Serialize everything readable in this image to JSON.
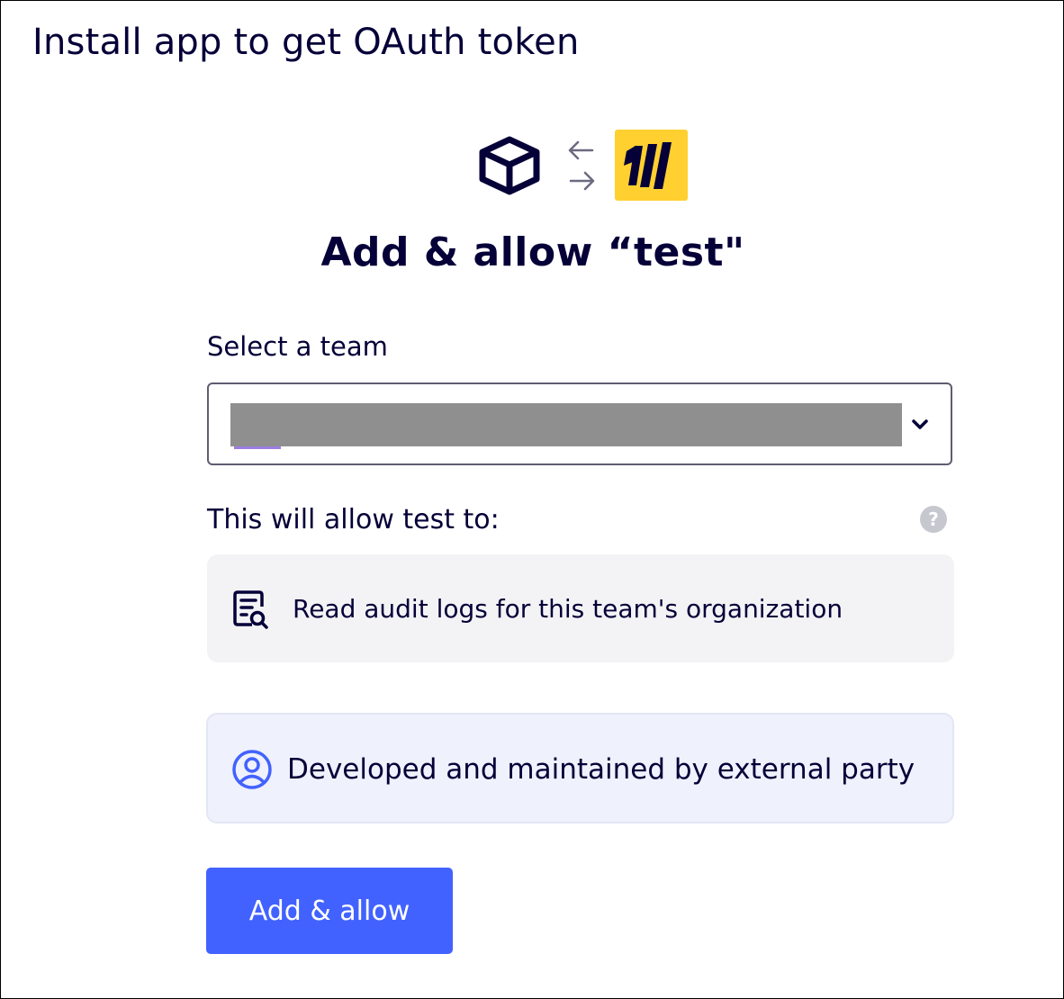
{
  "page": {
    "title": "Install app to get OAuth token"
  },
  "header_icons": {
    "app_icon": "cube-icon",
    "swap_icon": "swap-arrows-icon",
    "brand_logo": "miro-logo",
    "brand_logo_color": "#FFD02F"
  },
  "dialog": {
    "heading": "Add & allow “test\"",
    "team_label": "Select a team",
    "team_select": {
      "selected_value": "",
      "redacted": true,
      "icon": "chevron-down-icon"
    },
    "permissions_label": "This will allow test to:",
    "help_icon": "?",
    "permissions": [
      {
        "icon": "audit-log-icon",
        "text": "Read audit logs for this team's organization"
      }
    ],
    "developer_notice": {
      "icon": "user-circle-icon",
      "text": "Developed and maintained by external party"
    },
    "submit_label": "Add & allow"
  },
  "colors": {
    "text_primary": "#050038",
    "accent_blue": "#4262ff",
    "permission_card_bg": "#f3f3f6",
    "developer_card_bg": "#eff1fc",
    "help_icon_bg": "#c7c7cf"
  }
}
